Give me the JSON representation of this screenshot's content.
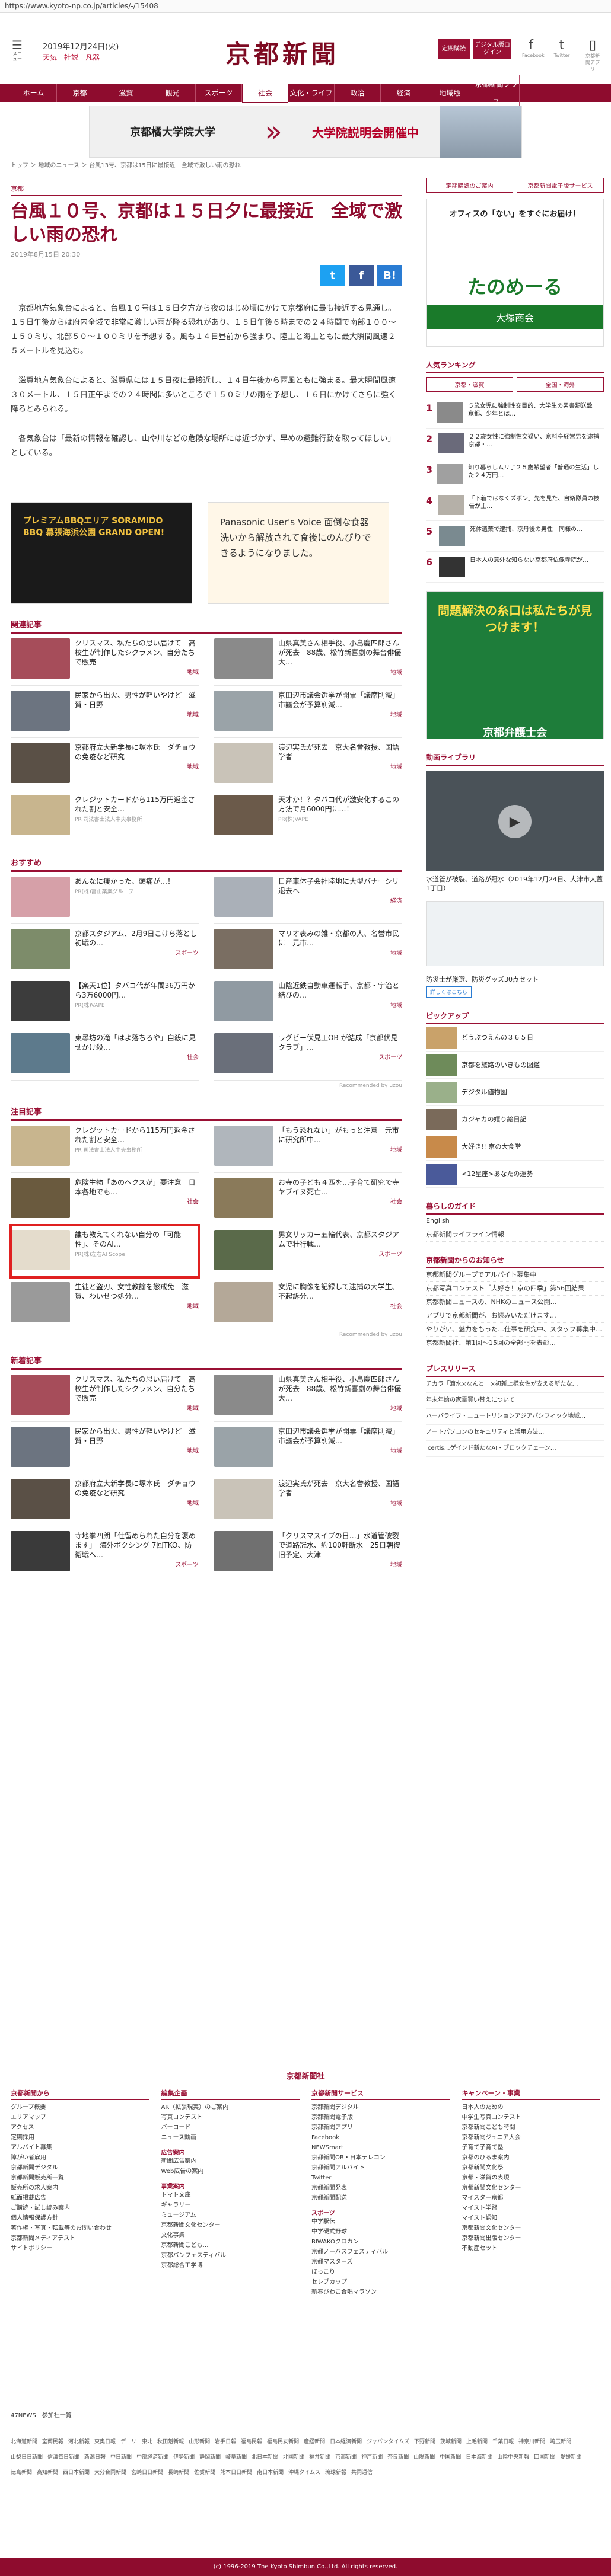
{
  "url": "https://www.kyoto-np.co.jp/articles/-/15408",
  "header": {
    "menu": "メニュー",
    "date": "2019年12月24日(火)",
    "weather": [
      "天気",
      "社説",
      "凡器"
    ],
    "logo": "京都新聞",
    "btn1": "定期購読",
    "btn2": "デジタル版ログイン",
    "social": [
      "Facebook",
      "Twitter",
      "京都新聞アプリ"
    ]
  },
  "nav": [
    "ホーム",
    "京都",
    "滋賀",
    "観光",
    "スポーツ",
    "社会",
    "文化・ライフ",
    "政治",
    "経済",
    "地域版",
    "京都新聞プラス"
  ],
  "topad": {
    "left": "京都橘大学院大学",
    "right": "大学院説明会開催中"
  },
  "breadcrumb": "トップ ＞ 地域のニュース ＞ 台風13号、京都は15日に最接近　全域で激しい雨の恐れ",
  "article": {
    "category": "京都",
    "title": "台風１０号、京都は１５日夕に最接近　全域で激しい雨の恐れ",
    "date": "2019年8月15日 20:30",
    "share": [
      "t",
      "f",
      "B!"
    ],
    "p1": "京都地方気象台によると、台風１０号は１５日夕方から夜のはじめ頃にかけて京都府に最も接近する見通し。１５日午後からは府内全域で非常に激しい雨が降る恐れがあり、１５日午後６時までの２４時間で南部１００～１５０ミリ、北部５０～１００ミリを予想する。風も１４日昼前から強まり、陸上と海上ともに最大瞬間風速２５メートルを見込む。",
    "p2": "滋賀地方気象台によると、滋賀県には１５日夜に最接近し、１４日午後から雨風ともに強まる。最大瞬間風速３０メートル、１５日正午までの２４時間に多いところで１５０ミリの雨を予想し、１６日にかけてさらに強く降るとみられる。",
    "p3": "各気象台は「最新の情報を確認し、山や川などの危険な場所には近づかず、早めの避難行動を取ってほしい」としている。"
  },
  "ads": {
    "a": "プレミアムBBQエリア SORAMIDO BBQ 幕張海浜公園 GRAND OPEN!",
    "b": "Panasonic User's Voice 面倒な食器洗いから解放されて食後にのんびりできるようになりました。"
  },
  "related": {
    "title": "関連記事",
    "items": [
      {
        "t": "クリスマス、私たちの思い届けて　高校生が制作したシクラメン、自分たちで販売",
        "tag": "地域"
      },
      {
        "t": "山県真美さん相手役、小島慶四郎さんが死去　88歳、松竹新喜劇の舞台俳優大…",
        "tag": "地域"
      },
      {
        "t": "民家から出火、男性が軽いやけど　滋賀・日野",
        "tag": "地域"
      },
      {
        "t": "京田辺市議会選挙が開票「議席削減」市議会が予算削減…",
        "tag": "地域"
      },
      {
        "t": "京都府立大新学長に塚本氏　ダチョウの免疫など研究",
        "tag": "地域"
      },
      {
        "t": "渡辺実氏が死去　京大名誉教授、国語学者",
        "tag": "地域"
      },
      {
        "t": "クレジットカードから115万円返金された割と安全…",
        "src": "PR 司法書士法人中央事務所"
      },
      {
        "t": "天才か！？タバコ代が激安化するこの方法で月6000円に…！",
        "src": "PR(株)VAPE"
      }
    ]
  },
  "recommend": {
    "title": "おすすめ",
    "items": [
      {
        "t": "あんなに痩かった、頭痛が…！",
        "src": "PR(株)富山薬業グループ"
      },
      {
        "t": "日産車体子会社陸地に大型バナーシリ退去へ",
        "tag": "経済"
      },
      {
        "t": "京都スタジアム、2月9日こけら落とし　初戦の…",
        "tag": "スポーツ"
      },
      {
        "t": "マリオ表みの雑・京都の人、名誉市民に　元市…",
        "tag": "地域"
      },
      {
        "t": "【楽天1位】タバコ代が年間36万円から3万6000円…",
        "src": "PR(株)VAPE"
      },
      {
        "t": "山陰近鉄自動車運転手、京都・宇治と結びの…",
        "tag": "地域"
      },
      {
        "t": "東尋坊の滝「はよ落ちろや」自殺に見せかけ殺…",
        "tag": "社会"
      },
      {
        "t": "ラグビー伏見工OB が結成「京都伏見クラブ」…",
        "tag": "スポーツ"
      }
    ],
    "credit": "Recommended by uzou"
  },
  "attention": {
    "title": "注目記事",
    "items": [
      {
        "t": "クレジットカードから115万円返金された割と安全…",
        "src": "PR 司法書士法人中央事務所"
      },
      {
        "t": "「もう恐れない」がもっと注意　元市に研究所中…",
        "tag": "地域"
      },
      {
        "t": "危険生物「あのヘクスが」要注意　日本各地でも…",
        "tag": "社会"
      },
      {
        "t": "お寺の子ども４匹を…子育て研究で寺ヤブイヌ死亡…",
        "tag": "社会"
      },
      {
        "t": "誰も教えてくれない自分の「可能性」、そのAI…",
        "src": "PR(株)左右AI Scope"
      },
      {
        "t": "男女サッカー五輪代表、京都スタジアムで壮行戦…",
        "tag": "スポーツ"
      },
      {
        "t": "生徒と盗刃、女性教諭を懲戒免　滋賀、わいせつ処分…",
        "tag": "地域"
      },
      {
        "t": "女児に胸像を記録して逮捕の大学生、不起訴分…",
        "tag": "社会"
      }
    ],
    "credit": "Recommended by uzou"
  },
  "latest": {
    "title": "新着記事",
    "items": [
      {
        "t": "クリスマス、私たちの思い届けて　高校生が制作したシクラメン、自分たちで販売",
        "tag": "地域"
      },
      {
        "t": "山県真美さん相手役、小島慶四郎さんが死去　88歳、松竹新喜劇の舞台俳優大…",
        "tag": "地域"
      },
      {
        "t": "民家から出火、男性が軽いやけど　滋賀・日野",
        "tag": "地域"
      },
      {
        "t": "京田辺市議会選挙が開票「議席削減」市議会が予算削減…",
        "tag": "地域"
      },
      {
        "t": "京都府立大新学長に塚本氏　ダチョウの免疫など研究",
        "tag": "地域"
      },
      {
        "t": "渡辺実氏が死去　京大名誉教授、国語学者",
        "tag": "地域"
      },
      {
        "t": "寺地拳四朗「仕留められた自分を褒めます」　海外ボクシング 7回TKO、防衛戦へ…",
        "tag": "スポーツ"
      },
      {
        "t": "「クリスマスイブの日…」水道管破裂で道路冠水、約100軒断水　25日朝復旧予定、大津",
        "tag": "地域"
      }
    ]
  },
  "side": {
    "btn1": "定期購読のご案内",
    "btn2": "京都新聞電子版サービス",
    "ad1": {
      "h": "オフィスの「ない」をすぐにお届け！",
      "m": "たのめーる",
      "f": "大塚商会"
    },
    "rankTitle": "人気ランキング",
    "rankTabs": [
      "京都・滋賀",
      "全国・海外"
    ],
    "rank": [
      "５歳女児に強制性交目的、大学生の男書類送致　京都、少年とは…",
      "２２歳女性に強制性交疑い、京料亭経営男を逮捕　京都・…",
      "知り暮らしムリ了２５歳希望者「普通の生活」した２４万円…",
      "「下着ではなくズボン」先を見た、自衛隊員の被告が主…",
      "死体遺棄で逮捕、京丹後の男性　同様の…",
      "日本人の意外な知らない京都府仏像寺院が…"
    ],
    "ad2": {
      "h": "問題解決の糸口は私たちが見つけます！",
      "f": "京都弁護士会"
    },
    "videoTitle": "動画ライブラリ",
    "videoCap": "水道管が破裂、道路が冠水（2019年12月24日、大津市大萱1丁目）",
    "ad3": "防災士が厳選、防災グッズ30点セット",
    "ad3btn": "詳しくはこちら",
    "pickTitle": "ピックアップ",
    "picks": [
      "どうぶつえんの３６５日",
      "京都を旅路のいきもの図鑑",
      "デジタル値物園",
      "カジャカの嬉り絵日記",
      "大好き!! 京の大食堂",
      "<12星座>あなたの運勢"
    ],
    "guideTitle": "暮らしのガイド",
    "guide": [
      "English",
      "京都新聞ライフライン情報"
    ],
    "infoTitle": "京都新聞からのお知らせ",
    "info": [
      "京都新聞グループでアルバイト募集中",
      "京都写真コンテスト「大好き！京の四季」第56回結果",
      "京都新聞ニュースの、NHKのニュース公開…",
      "アプリで京都新聞が、お読みいただけます…",
      "やりがい、魅力をもった…仕事を研究中、スタッフ募集中…",
      "京都新聞社、第1回～15回の全部門を表彰…"
    ],
    "prTitle": "プレスリリース",
    "pr": [
      "チカラ「滴水×なんと」×初新上様女性が支える新たな…",
      "年末年始の家電買い替えについて",
      "ハーバライフ・ニュートリションアジアパシフィック地域…",
      "ノートパソコンのセキュリティと活用方法…",
      "Icertis…ゲインド新たなAI・ブロックチェーン…"
    ]
  },
  "footer": {
    "company": "京都新聞社",
    "cols": [
      {
        "h": "京都新聞から",
        "items": [
          "グループ概要",
          "エリアマップ",
          "アクセス",
          "定期採用",
          "アルバイト募集",
          "障がい者雇用",
          "京都新聞デジタル",
          "京都新聞販売所一覧",
          "販売所の求人案内",
          "紙面掲載広告",
          "ご購読・試し読み案内",
          "個人情報保護方針",
          "著作権・写真・転載等のお問い合わせ",
          "京都新聞メディアテスト",
          "サイトポリシー"
        ]
      },
      {
        "h": "編集企画",
        "items": [
          "AR（拡張現実）のご案内",
          "写真コンテスト",
          "バーコード",
          "ニュース動画"
        ],
        "h2": "広告案内",
        "items2": [
          "新聞広告案内",
          "Web広告の案内"
        ],
        "h3": "事業案内",
        "items3": [
          "トマト文庫",
          "ギャラリー",
          "ミュージアム",
          "京都新聞文化センター",
          "文化事業",
          "京都新聞こども…",
          "京都バンフェスティバル",
          "京都総合工学博"
        ]
      },
      {
        "h": "京都新聞サービス",
        "items": [
          "京都新聞デジタル",
          "京都新聞電子版",
          "京都新聞アプリ",
          "Facebook",
          "NEWSmart",
          "京都新聞OB・日本テレコン",
          "京都新聞アルバイト",
          "Twitter",
          "京都新聞発表",
          "京都新聞配送"
        ],
        "h2": "スポーツ",
        "items2": [
          "中学駅伝",
          "中学硬式野球",
          "BIWAKOクロカン",
          "京都ノーバスフェスティバル",
          "京都マスターズ",
          "ほっこり",
          "セレブカップ",
          "新春びわこ合唱マラソン"
        ]
      },
      {
        "h": "キャンペーン・事業",
        "items": [
          "日本人のための",
          "中学生写真コンテスト",
          "京都新聞こども時間",
          "京都新聞ジュニア大会",
          "子育て子育て塾",
          "京都のひるま案内",
          "京都新聞文化祭",
          "京都・滋賀の表現",
          "京都新聞文化センター",
          "マイスター京都",
          "マイスト学習",
          "マイスト認知",
          "京都新聞文化センター",
          "京都新聞出版センター",
          "不動産セット"
        ]
      }
    ],
    "n47": "47NEWS　参加社一覧",
    "members": [
      "北海道新聞",
      "室蘭民報",
      "河北新報",
      "東奥日報",
      "デーリー東北",
      "秋田魁新報",
      "山形新聞",
      "岩手日報",
      "福島民報",
      "福島民友新聞",
      "産経新聞",
      "日本経済新聞",
      "ジャパンタイムズ",
      "下野新聞",
      "茨城新聞",
      "上毛新聞",
      "千葉日報",
      "神奈川新聞",
      "埼玉新聞",
      "山梨日日新聞",
      "信濃毎日新聞",
      "新潟日報",
      "中日新聞",
      "中部経済新聞",
      "伊勢新聞",
      "静岡新聞",
      "岐阜新聞",
      "北日本新聞",
      "北國新聞",
      "福井新聞",
      "京都新聞",
      "神戸新聞",
      "奈良新聞",
      "山陽新聞",
      "中国新聞",
      "日本海新聞",
      "山陰中央新報",
      "四国新聞",
      "愛媛新聞",
      "徳島新聞",
      "高知新聞",
      "西日本新聞",
      "大分合同新聞",
      "宮崎日日新聞",
      "長崎新聞",
      "佐賀新聞",
      "熊本日日新聞",
      "南日本新聞",
      "沖縄タイムス",
      "琉球新報",
      "共同通信"
    ],
    "copy": "(c) 1996-2019 The Kyoto Shimbun Co.,Ltd. All rights reserved."
  }
}
